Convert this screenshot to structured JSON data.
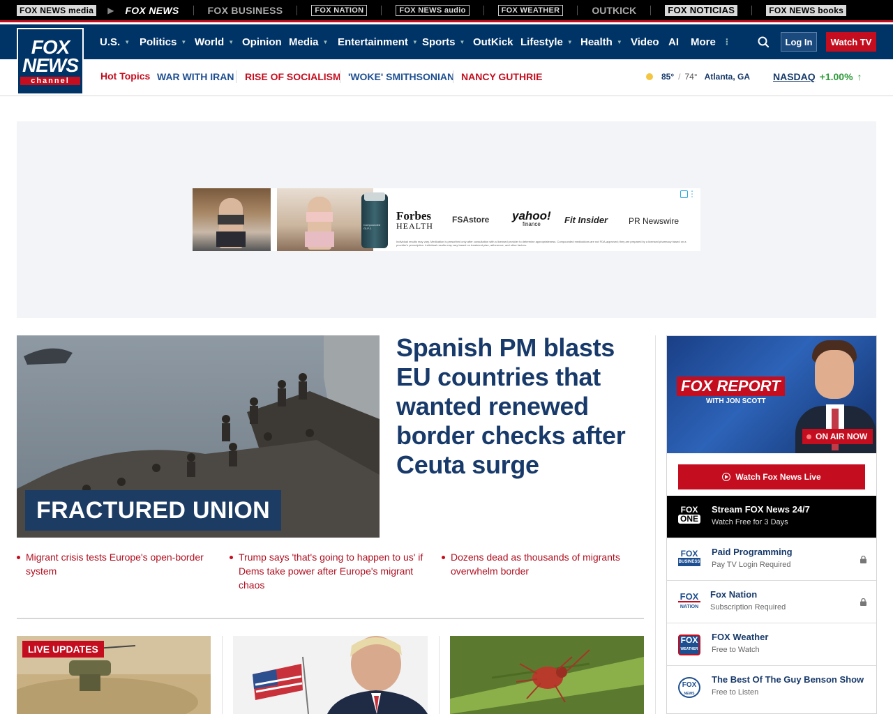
{
  "brand_bar": {
    "items": [
      {
        "label": "FOX NEWS media"
      },
      {
        "label": "FOX NEWS"
      },
      {
        "label": "FOX BUSINESS"
      },
      {
        "label": "FOX NATION"
      },
      {
        "label": "FOX NEWS audio"
      },
      {
        "label": "FOX WEATHER"
      },
      {
        "label": "OUTKICK"
      },
      {
        "label": "FOX NOTICIAS"
      },
      {
        "label": "FOX NEWS books"
      }
    ]
  },
  "logo": {
    "line1": "FOX",
    "line2": "NEWS",
    "line3": "channel"
  },
  "nav": {
    "items": [
      {
        "label": "U.S.",
        "dropdown": true
      },
      {
        "label": "Politics",
        "dropdown": true
      },
      {
        "label": "World",
        "dropdown": true
      },
      {
        "label": "Opinion",
        "dropdown": false
      },
      {
        "label": "Media",
        "dropdown": true
      },
      {
        "label": "Entertainment",
        "dropdown": true
      },
      {
        "label": "Sports",
        "dropdown": true
      },
      {
        "label": "OutKick",
        "dropdown": false
      },
      {
        "label": "Lifestyle",
        "dropdown": true
      },
      {
        "label": "Health",
        "dropdown": true
      },
      {
        "label": "Video",
        "dropdown": false
      },
      {
        "label": "AI",
        "dropdown": false
      },
      {
        "label": "More",
        "dropdown": true
      }
    ],
    "login": "Log In",
    "watch_tv": "Watch TV"
  },
  "hot_topics": {
    "label": "Hot Topics",
    "items": [
      {
        "label": "WAR WITH IRAN",
        "color": "#1d4f91"
      },
      {
        "label": "RISE OF SOCIALISM",
        "color": "#c40d1e"
      },
      {
        "label": "'WOKE' SMITHSONIAN",
        "color": "#1d4f91"
      },
      {
        "label": "NANCY GUTHRIE",
        "color": "#c40d1e"
      }
    ]
  },
  "weather": {
    "high": "85°",
    "sep": "/",
    "low": "74°",
    "location": "Atlanta, GA"
  },
  "market": {
    "name": "NASDAQ",
    "change": "+1.00%",
    "direction": "up"
  },
  "ad": {
    "brands": [
      "Forbes",
      "HEALTH",
      "FSAstore",
      "yahoo!",
      "finance",
      "Fit Insider",
      "PR Newswire"
    ],
    "vial_label": "Compounded GLP-1",
    "disclaimer": "Individual results may vary. Medication is prescribed only after consultation with a licensed provider to determine appropriateness. Compounded medications are not FDA-approved; they are prepared by a licensed pharmacy based on a provider's prescription. Individual results may vary based on treatment plan, adherence, and other factors."
  },
  "hero": {
    "label": "FRACTURED UNION",
    "title": "Spanish PM blasts EU countries that wanted renewed border checks after Ceuta surge",
    "related": [
      "Migrant crisis tests Europe's open-border system",
      "Trump says 'that's going to happen to us' if Dems take power after Europe's migrant chaos",
      "Dozens dead as thousands of migrants overwhelm border"
    ]
  },
  "cards": {
    "live_label": "LIVE UPDATES"
  },
  "sidebar": {
    "show_title": "FOX REPORT",
    "show_host": "WITH JON SCOTT",
    "on_air": "ON AIR NOW",
    "watch_live": "Watch Fox News Live",
    "fox_one": {
      "logo_top": "FOX",
      "logo_bottom": "ONE",
      "title": "Stream FOX News 24/7",
      "subtitle": "Watch Free for 3 Days"
    },
    "channels": [
      {
        "title": "Paid Programming",
        "subtitle": "Pay TV Login Required",
        "locked": true,
        "icon_text": "FOX",
        "icon_sub": "BUSINESS"
      },
      {
        "title": "Fox Nation",
        "subtitle": "Subscription Required",
        "locked": true,
        "icon_text": "FOX",
        "icon_sub": "NATION"
      },
      {
        "title": "FOX Weather",
        "subtitle": "Free to Watch",
        "locked": false,
        "icon_text": "FOX",
        "icon_sub": "WEATHER"
      },
      {
        "title": "The Best Of The Guy Benson Show",
        "subtitle": "Free to Listen",
        "locked": false,
        "icon_text": "FOX",
        "icon_sub": "NEWS"
      }
    ]
  }
}
